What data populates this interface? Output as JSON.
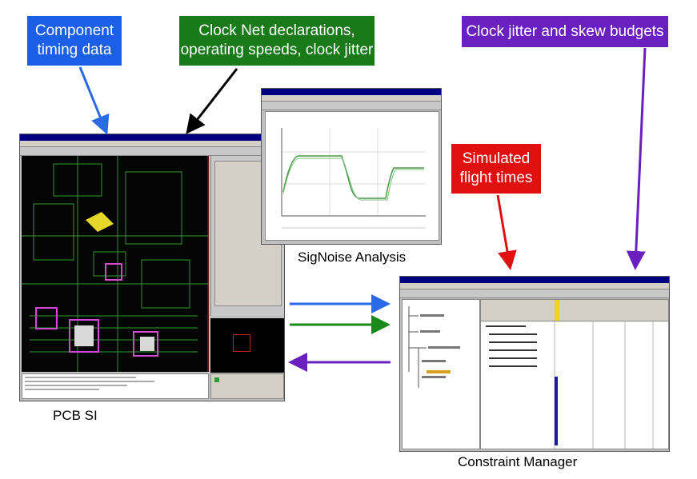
{
  "callouts": {
    "component_timing": "Component\ntiming data",
    "clock_net": "Clock Net declarations,\noperating speeds, clock jitter",
    "jitter_skew": "Clock jitter and skew budgets",
    "flight_times": "Simulated\nflight times"
  },
  "captions": {
    "pcb_si": "PCB SI",
    "signoise": "SigNoise Analysis",
    "constraint_manager": "Constraint Manager"
  },
  "colors": {
    "component_timing": "#1a5fe6",
    "clock_net": "#1a7a1a",
    "jitter_skew": "#6a1fbf",
    "flight_times": "#e01010",
    "arrow_blue": "#2a6ae6",
    "arrow_green": "#1a8a1a",
    "arrow_purple": "#6a1fbf",
    "arrow_black": "#000000"
  }
}
